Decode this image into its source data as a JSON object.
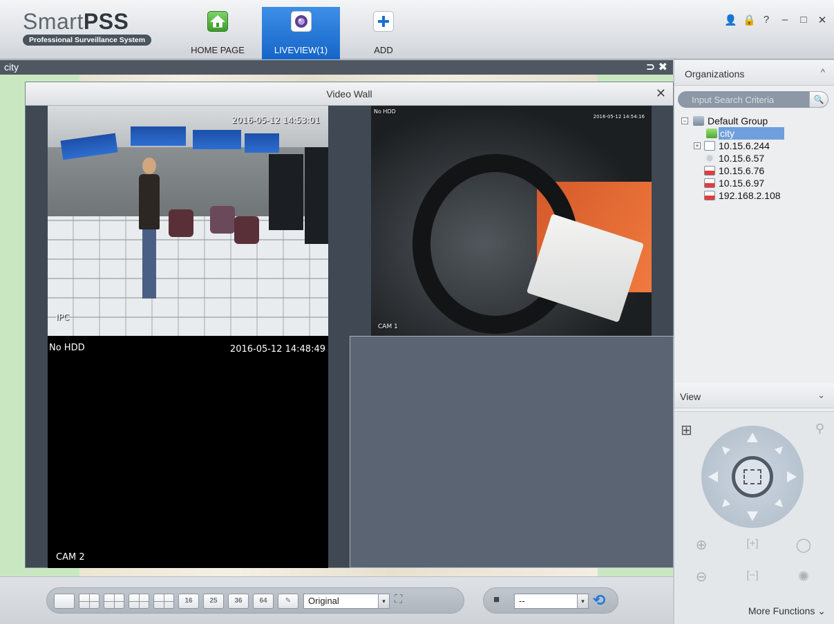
{
  "app": {
    "logo_text": "Smart",
    "logo_bold": "PSS",
    "logo_subtitle": "Professional Surveillance System"
  },
  "tabs": [
    {
      "label": "HOME PAGE",
      "icon": "home-icon"
    },
    {
      "label": "LIVEVIEW(1)",
      "icon": "camera-icon",
      "active": true
    },
    {
      "label": "ADD",
      "icon": "plus-icon"
    }
  ],
  "window_controls": [
    "user-icon",
    "lock-icon",
    "help-icon",
    "minimize-icon",
    "maximize-icon",
    "close-icon"
  ],
  "window_glyphs": {
    "user": "👤",
    "lock": "🔒",
    "help": "?",
    "minimize": "–",
    "maximize": "□",
    "close": "✕"
  },
  "map": {
    "title": "city",
    "back_glyph": "⊃",
    "close_glyph": "✖"
  },
  "video_wall": {
    "title": "Video Wall",
    "close_glyph": "✕",
    "cells": [
      {
        "timestamp": "2016-05-12 14:53:01",
        "channel": "IPC",
        "status": ""
      },
      {
        "timestamp": "2016-05-12 14:54:16",
        "channel": "CAM 1",
        "status": "No HDD"
      },
      {
        "timestamp": "2016-05-12 14:48:49",
        "channel": "CAM 2",
        "status": "No HDD"
      },
      {
        "timestamp": "",
        "channel": "",
        "status": ""
      }
    ]
  },
  "toolbar": {
    "layout_buttons": [
      "1",
      "4",
      "6",
      "8",
      "9",
      "16",
      "25",
      "36",
      "64",
      "custom"
    ],
    "layout_labels": {
      "b16": "16",
      "b25": "25",
      "b36": "36",
      "b64": "64",
      "custom": "✎"
    },
    "aspect_select": "Original",
    "fullscreen_glyph": "⛶",
    "save_glyph": "■",
    "view_select": "--",
    "select_arrow": "▾",
    "refresh_glyph": "⟲"
  },
  "right_panel": {
    "organizations_title": "Organizations",
    "collapse_glyph": "^",
    "search_placeholder": "Input Search Criteria",
    "search_glyph": "🔍",
    "tree": {
      "root": "Default Group",
      "root_expand": "−",
      "items": [
        {
          "label": "city",
          "selected": true
        },
        {
          "label": "10.15.6.244",
          "expand": "+"
        },
        {
          "label": "10.15.6.57"
        },
        {
          "label": "10.15.6.76"
        },
        {
          "label": "10.15.6.97"
        },
        {
          "label": "192.168.2.108"
        }
      ]
    },
    "view_title": "View",
    "view_chevron": "⌄",
    "ptz": {
      "grid_glyph": "⊞",
      "person_glyph": "⚲",
      "zoom_in": "⊕",
      "zoom_out": "⊖",
      "focus_near": "[+]",
      "focus_far": "[−]",
      "iris_open": "◯",
      "iris_close": "✺"
    },
    "more_functions": "More Functions ⌄"
  },
  "colors": {
    "accent_tab": "#1f74d6",
    "selected_row": "#6f9fdc",
    "map_green": "#c9e8c2"
  }
}
